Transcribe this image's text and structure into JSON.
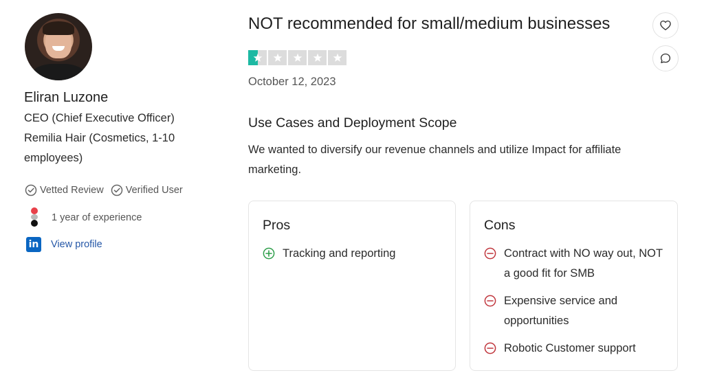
{
  "reviewer": {
    "name": "Eliran Luzone",
    "role": "CEO (Chief Executive Officer)",
    "company": "Remilia Hair (Cosmetics, 1-10 employees)",
    "badges": [
      "Vetted Review",
      "Verified User"
    ],
    "experience": "1 year of experience",
    "profile_link": "View profile",
    "linkedin_icon_text": "in"
  },
  "review": {
    "title": "NOT recommended for small/medium businesses",
    "rating": 1,
    "rating_max": 5,
    "date": "October 12, 2023",
    "use_cases": {
      "heading": "Use Cases and Deployment Scope",
      "body": "We wanted to diversify our revenue channels and utilize Impact for affiliate marketing."
    },
    "pros": {
      "heading": "Pros",
      "items": [
        "Tracking and reporting"
      ]
    },
    "cons": {
      "heading": "Cons",
      "items": [
        "Contract with NO way out, NOT a good fit for SMB",
        "Expensive service and opportunities",
        "Robotic Customer support"
      ]
    }
  },
  "icons": {
    "like": "heart-icon",
    "comment": "comment-icon",
    "vetted": "check-circle-icon",
    "verified": "check-circle-icon",
    "pro": "plus-circle-icon",
    "con": "minus-circle-icon"
  },
  "colors": {
    "star_fill": "#1db9a3",
    "star_empty": "#dcdcdc",
    "pro_icon": "#2e9e4a",
    "con_icon": "#c0363d",
    "link": "#2557a7",
    "linkedin": "#0a66c2"
  }
}
